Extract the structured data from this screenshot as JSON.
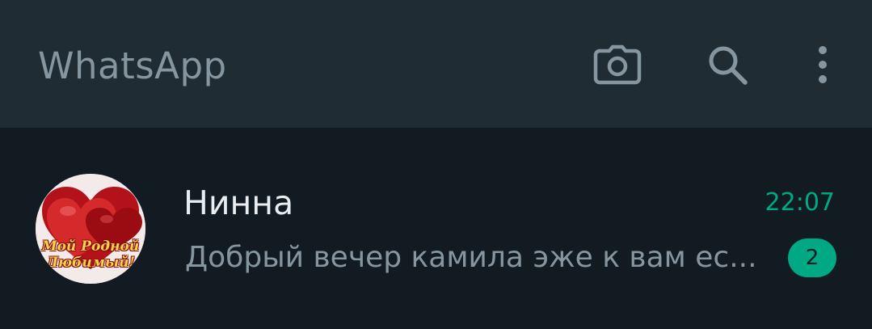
{
  "header": {
    "title": "WhatsApp",
    "icons": [
      "camera-icon",
      "search-icon",
      "more-vertical-icon"
    ]
  },
  "chats": [
    {
      "name": "Нинна",
      "time": "22:07",
      "last_message": "Добрый вечер камила эже к вам ес...",
      "unread_count": "2",
      "avatar_caption_line1": "Мой Родной",
      "avatar_caption_line2": "Любимый!"
    }
  ],
  "colors": {
    "header_bg": "#1f2c34",
    "list_bg": "#121b22",
    "accent": "#00a884",
    "muted_text": "#8696a0",
    "primary_text": "#e9edef"
  }
}
